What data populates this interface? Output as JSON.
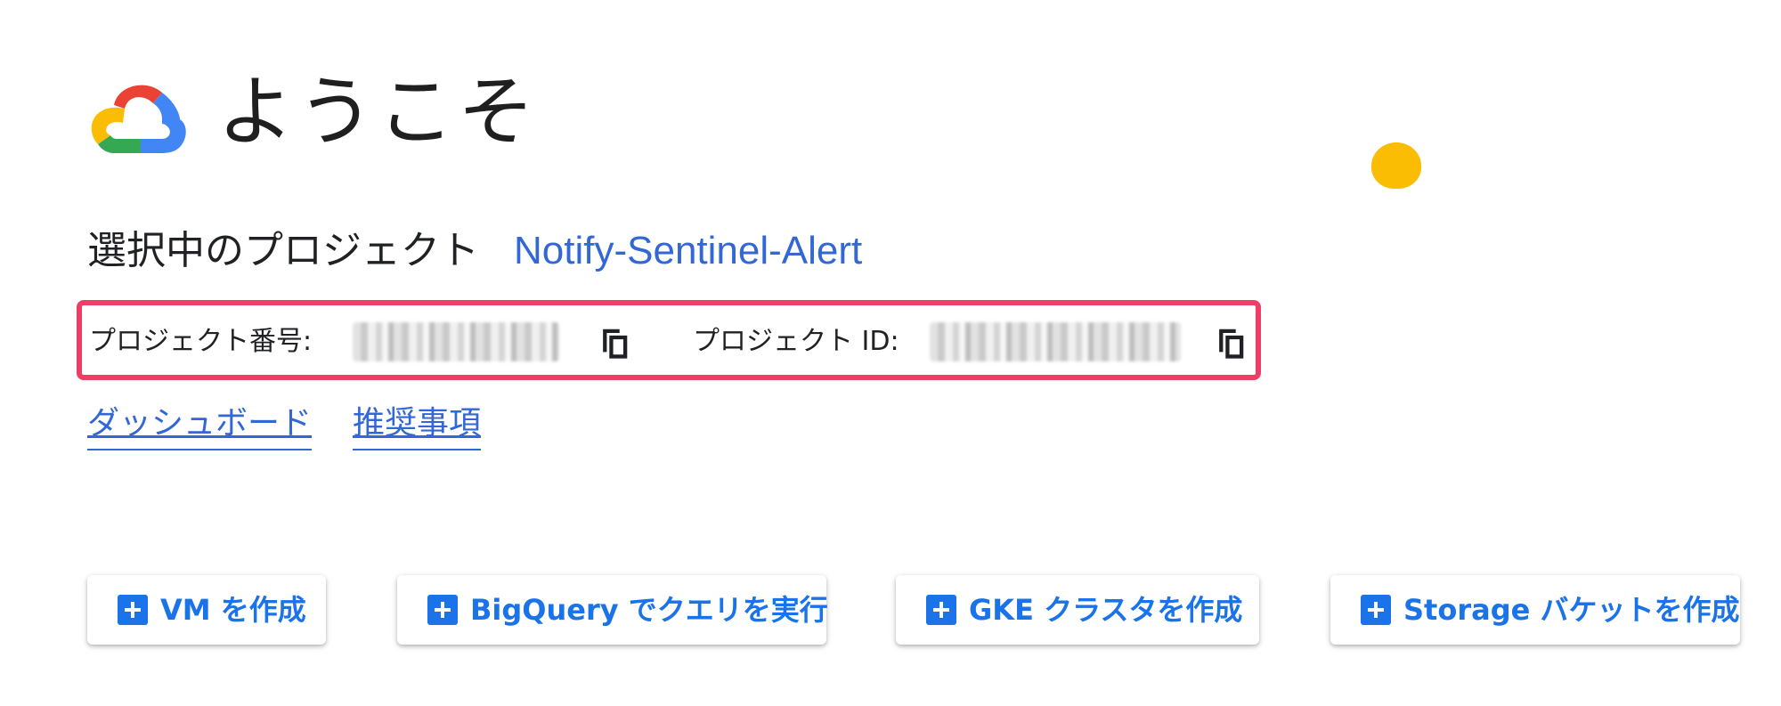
{
  "header": {
    "title": "ようこそ",
    "logo_icon": "google-cloud-logo",
    "decor_icon": "yellow-blob-icon"
  },
  "project": {
    "selected_label": "選択中のプロジェクト",
    "selected_name": "Notify-Sentinel-Alert",
    "number_label": "プロジェクト番号:",
    "id_label": "プロジェクト ID:",
    "copy_icon": "content-copy-icon"
  },
  "links": {
    "dashboard": "ダッシュボード",
    "recommendations": "推奨事項"
  },
  "actions": [
    {
      "label": "VM を作成",
      "icon": "add-box-icon"
    },
    {
      "label": "BigQuery でクエリを実行",
      "icon": "add-box-icon"
    },
    {
      "label": "GKE クラスタを作成",
      "icon": "add-box-icon"
    },
    {
      "label": "Storage バケットを作成",
      "icon": "add-box-icon"
    }
  ],
  "colors": {
    "link": "#3367d6",
    "highlight": "#ee3e68",
    "button_text": "#1a73e8",
    "yellow": "#fbbc04"
  }
}
